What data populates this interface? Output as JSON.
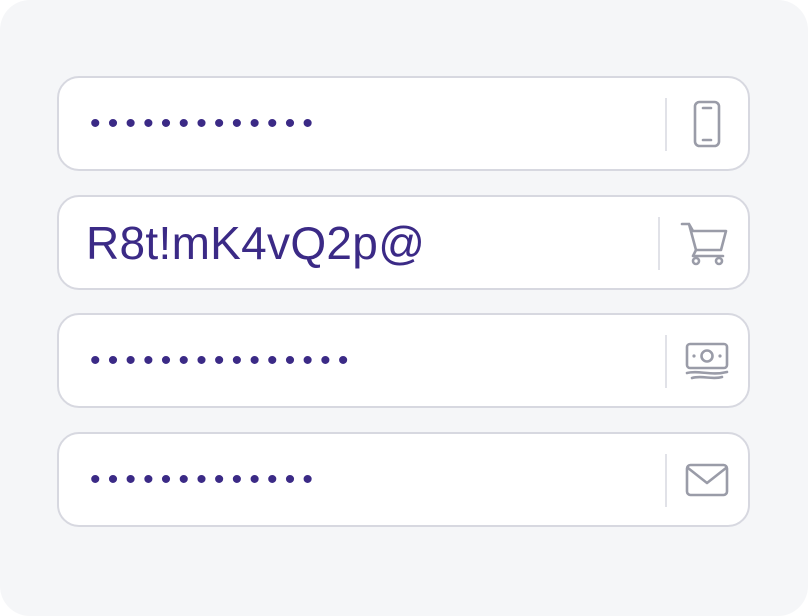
{
  "colors": {
    "card_background": "#f5f6f8",
    "field_border": "#d7d8e0",
    "text": "#3b2a86",
    "icon": "#9a9ca8"
  },
  "fields": [
    {
      "id": "phone",
      "value": "•••••••••••••",
      "masked": true,
      "icon": "smartphone-icon"
    },
    {
      "id": "shopping",
      "value": "R8t!mK4vQ2p@",
      "masked": false,
      "icon": "shopping-cart-icon"
    },
    {
      "id": "banking",
      "value": "•••••••••••••••",
      "masked": true,
      "icon": "money-banknote-icon"
    },
    {
      "id": "email",
      "value": "•••••••••••••",
      "masked": true,
      "icon": "envelope-icon"
    }
  ]
}
